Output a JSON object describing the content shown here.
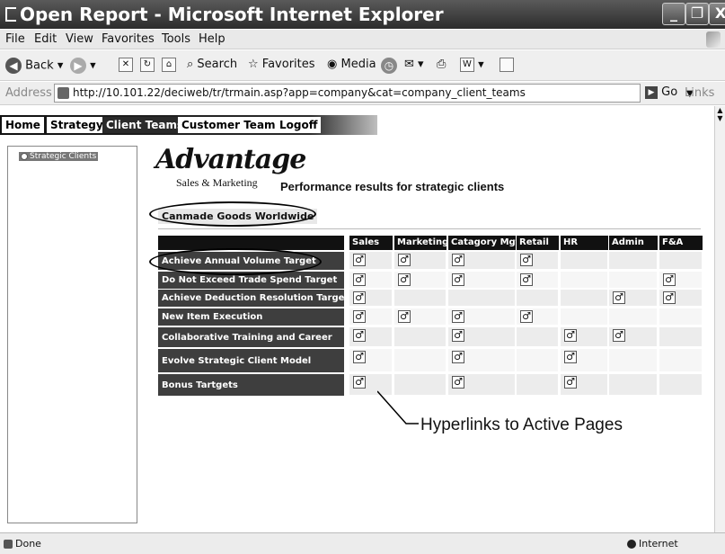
{
  "window": {
    "title": "Open Report - Microsoft Internet Explorer",
    "minimize": "_",
    "maximize": "❐",
    "close": "X"
  },
  "menu": [
    "File",
    "Edit",
    "View",
    "Favorites",
    "Tools",
    "Help"
  ],
  "toolbar": {
    "back": "Back",
    "search": "Search",
    "favorites": "Favorites",
    "media": "Media"
  },
  "address": {
    "label": "Address",
    "url": "http://10.101.22/deciweb/tr/trmain.asp?app=company&cat=company_client_teams",
    "go": "Go",
    "links": "Links"
  },
  "tabs": [
    {
      "label": "Home",
      "active": false
    },
    {
      "label": "Strategy",
      "active": false
    },
    {
      "label": "Client Teams",
      "active": true
    },
    {
      "label": "Customer Teams",
      "active": false
    },
    {
      "label": "Logoff",
      "active": false
    }
  ],
  "tree": {
    "item": "Strategic Clients"
  },
  "brand": {
    "logo": "Advantage",
    "subtitle": "Sales & Marketing",
    "heading": "Performance results for strategic clients"
  },
  "client": "Canmade Goods Worldwide",
  "matrix": {
    "columns": [
      "Sales",
      "Marketing",
      "Catagory Mgt.",
      "Retail",
      "HR",
      "Admin",
      "F&A"
    ],
    "rows": [
      {
        "label": "Achieve Annual Volume Target",
        "checks": [
          1,
          1,
          1,
          1,
          0,
          0,
          0
        ]
      },
      {
        "label": "Do Not Exceed Trade Spend Target",
        "checks": [
          1,
          1,
          1,
          1,
          0,
          0,
          1
        ]
      },
      {
        "label": "Achieve Deduction Resolution Target",
        "checks": [
          1,
          0,
          0,
          0,
          0,
          1,
          1
        ]
      },
      {
        "label": "New Item Execution",
        "checks": [
          1,
          1,
          1,
          1,
          0,
          0,
          0
        ]
      },
      {
        "label": "Collaborative Training and Career",
        "checks": [
          1,
          0,
          1,
          0,
          1,
          1,
          0
        ]
      },
      {
        "label": "Evolve Strategic Client Model",
        "checks": [
          1,
          0,
          1,
          0,
          1,
          0,
          0
        ]
      },
      {
        "label": "Bonus Tartgets",
        "checks": [
          1,
          0,
          1,
          0,
          1,
          0,
          0
        ]
      }
    ],
    "check_glyph": "♂"
  },
  "callout": "Hyperlinks to Active Pages",
  "status": {
    "left": "Done",
    "zone": "Internet"
  }
}
